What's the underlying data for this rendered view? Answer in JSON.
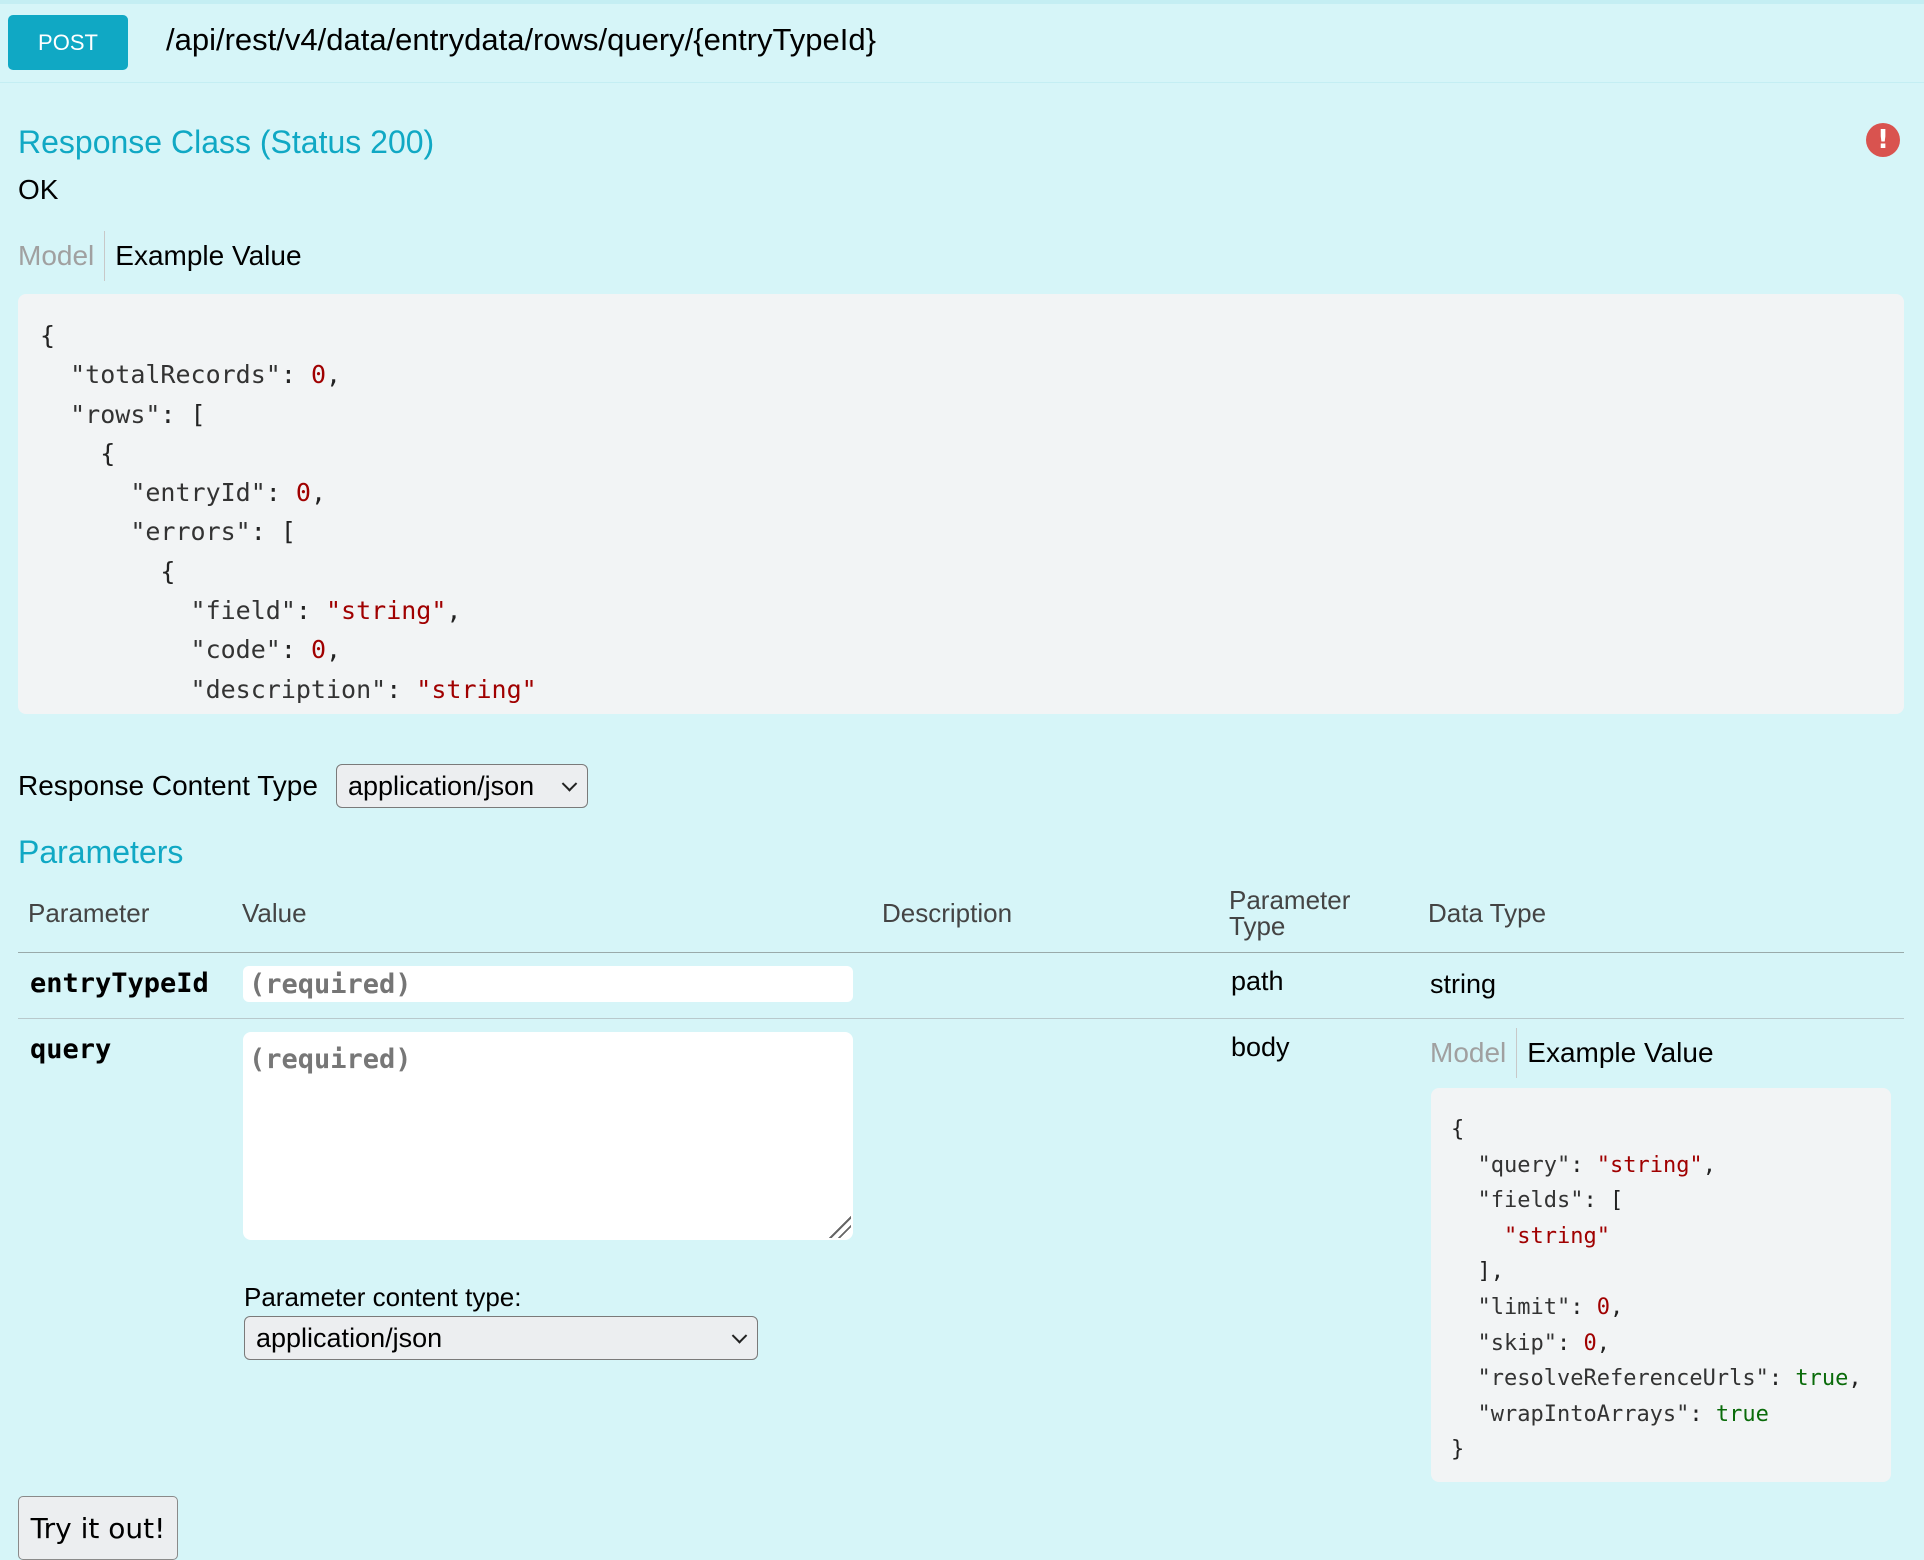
{
  "header": {
    "method": "POST",
    "path": "/api/rest/v4/data/entrydata/rows/query/{entryTypeId}"
  },
  "response": {
    "title": "Response Class (Status 200)",
    "status_text": "OK",
    "tab_model": "Model",
    "tab_example": "Example Value",
    "warning_icon": "exclamation-circle-icon",
    "example_lines": [
      [
        {
          "t": "p",
          "v": "{"
        }
      ],
      [
        {
          "t": "p",
          "v": "  "
        },
        {
          "t": "k",
          "v": "\"totalRecords\""
        },
        {
          "t": "p",
          "v": ": "
        },
        {
          "t": "n",
          "v": "0"
        },
        {
          "t": "p",
          "v": ","
        }
      ],
      [
        {
          "t": "p",
          "v": "  "
        },
        {
          "t": "k",
          "v": "\"rows\""
        },
        {
          "t": "p",
          "v": ": ["
        }
      ],
      [
        {
          "t": "p",
          "v": "    {"
        }
      ],
      [
        {
          "t": "p",
          "v": "      "
        },
        {
          "t": "k",
          "v": "\"entryId\""
        },
        {
          "t": "p",
          "v": ": "
        },
        {
          "t": "n",
          "v": "0"
        },
        {
          "t": "p",
          "v": ","
        }
      ],
      [
        {
          "t": "p",
          "v": "      "
        },
        {
          "t": "k",
          "v": "\"errors\""
        },
        {
          "t": "p",
          "v": ": ["
        }
      ],
      [
        {
          "t": "p",
          "v": "        {"
        }
      ],
      [
        {
          "t": "p",
          "v": "          "
        },
        {
          "t": "k",
          "v": "\"field\""
        },
        {
          "t": "p",
          "v": ": "
        },
        {
          "t": "s",
          "v": "\"string\""
        },
        {
          "t": "p",
          "v": ","
        }
      ],
      [
        {
          "t": "p",
          "v": "          "
        },
        {
          "t": "k",
          "v": "\"code\""
        },
        {
          "t": "p",
          "v": ": "
        },
        {
          "t": "n",
          "v": "0"
        },
        {
          "t": "p",
          "v": ","
        }
      ],
      [
        {
          "t": "p",
          "v": "          "
        },
        {
          "t": "k",
          "v": "\"description\""
        },
        {
          "t": "p",
          "v": ": "
        },
        {
          "t": "s",
          "v": "\"string\""
        }
      ]
    ]
  },
  "response_content_type": {
    "label": "Response Content Type",
    "selected": "application/json"
  },
  "parameters": {
    "title": "Parameters",
    "columns": [
      "Parameter",
      "Value",
      "Description",
      "Parameter Type",
      "Data Type"
    ],
    "rows": [
      {
        "name": "entryTypeId",
        "placeholder": "(required)",
        "param_type": "path",
        "data_type": "string"
      },
      {
        "name": "query",
        "placeholder": "(required)",
        "param_type": "body",
        "content_type_label": "Parameter content type:",
        "content_type_selected": "application/json",
        "tab_model": "Model",
        "tab_example": "Example Value"
      }
    ],
    "query_example_lines": [
      [
        {
          "t": "p",
          "v": "{"
        }
      ],
      [
        {
          "t": "p",
          "v": "  "
        },
        {
          "t": "k",
          "v": "\"query\""
        },
        {
          "t": "p",
          "v": ": "
        },
        {
          "t": "s",
          "v": "\"string\""
        },
        {
          "t": "p",
          "v": ","
        }
      ],
      [
        {
          "t": "p",
          "v": "  "
        },
        {
          "t": "k",
          "v": "\"fields\""
        },
        {
          "t": "p",
          "v": ": ["
        }
      ],
      [
        {
          "t": "p",
          "v": "    "
        },
        {
          "t": "s",
          "v": "\"string\""
        }
      ],
      [
        {
          "t": "p",
          "v": "  ],"
        }
      ],
      [
        {
          "t": "p",
          "v": "  "
        },
        {
          "t": "k",
          "v": "\"limit\""
        },
        {
          "t": "p",
          "v": ": "
        },
        {
          "t": "n",
          "v": "0"
        },
        {
          "t": "p",
          "v": ","
        }
      ],
      [
        {
          "t": "p",
          "v": "  "
        },
        {
          "t": "k",
          "v": "\"skip\""
        },
        {
          "t": "p",
          "v": ": "
        },
        {
          "t": "n",
          "v": "0"
        },
        {
          "t": "p",
          "v": ","
        }
      ],
      [
        {
          "t": "p",
          "v": "  "
        },
        {
          "t": "k",
          "v": "\"resolveReferenceUrls\""
        },
        {
          "t": "p",
          "v": ": "
        },
        {
          "t": "b",
          "v": "true"
        },
        {
          "t": "p",
          "v": ","
        }
      ],
      [
        {
          "t": "p",
          "v": "  "
        },
        {
          "t": "k",
          "v": "\"wrapIntoArrays\""
        },
        {
          "t": "p",
          "v": ": "
        },
        {
          "t": "b",
          "v": "true"
        }
      ],
      [
        {
          "t": "p",
          "v": "}"
        }
      ]
    ]
  },
  "actions": {
    "try_label": "Try it out!"
  },
  "colors": {
    "accent": "#10a8c4",
    "background": "#d6f5f8",
    "code_background": "#f2f4f5",
    "number": "#a00000",
    "boolean": "#0a6b0a",
    "warning": "#d9534f"
  }
}
